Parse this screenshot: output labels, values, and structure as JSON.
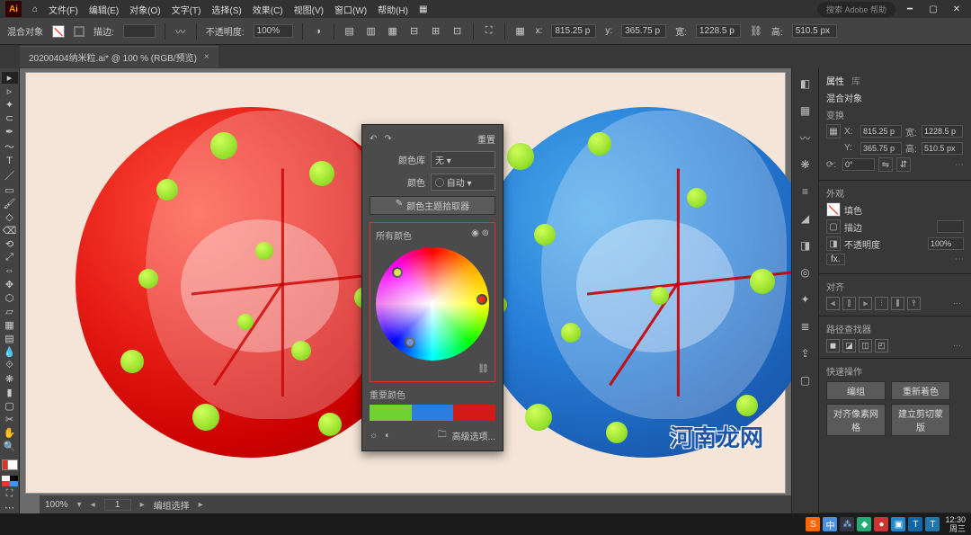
{
  "menu": {
    "items": [
      "文件(F)",
      "编辑(E)",
      "对象(O)",
      "文字(T)",
      "选择(S)",
      "效果(C)",
      "视图(V)",
      "窗口(W)",
      "帮助(H)"
    ],
    "search_placeholder": "搜索 Adobe 帮助"
  },
  "control": {
    "label_blend": "混合对象",
    "label_stroke": "描边:",
    "stroke_value": "",
    "label_opacity": "不透明度:",
    "opacity_value": "100%",
    "coords": {
      "x_lab": "x:",
      "x": "815.25 p",
      "y_lab": "y:",
      "365": "365.75 p",
      "w_lab": "宽:",
      "w": "1228.5 p",
      "h_lab": "高:",
      "h": "510.5 px"
    }
  },
  "tab": {
    "title": "20200404纳米粒.ai* @ 100 % (RGB/预览)"
  },
  "status": {
    "zoom": "100%",
    "mode": "编组选择"
  },
  "recolor": {
    "reset": "重置",
    "lib_label": "颜色库",
    "lib_value": "无",
    "colors_label": "颜色",
    "colors_value": "自动",
    "theme_btn": "颜色主题拾取器",
    "all_colors": "所有颜色",
    "prominent": "重要颜色",
    "advanced": "高级选项..."
  },
  "right": {
    "props_tab": "属性",
    "libs_tab": "库",
    "obj_title": "混合对象",
    "transform": "变换",
    "x_lab": "X:",
    "x": "815.25 p",
    "y_lab": "Y:",
    "y": "365.75 p",
    "w_lab": "宽:",
    "w": "1228.5 p",
    "h_lab": "高:",
    "h": "510.5 px",
    "rot_lab": "⟳:",
    "rot": "0°",
    "appearance": "外观",
    "fill": "填色",
    "stroke": "描边",
    "opacity_lab": "不透明度",
    "opacity": "100%",
    "fx": "fx.",
    "align": "对齐",
    "pathfinder": "路径查找器",
    "quick": "快速操作",
    "btn_recolor": "重新着色",
    "btn_group": "编组",
    "btn_pixel": "对齐像素网格",
    "btn_expand": "建立剪切蒙版"
  },
  "taskbar": {
    "time": "12:30",
    "day": "周三"
  },
  "watermark": "河南龙网"
}
